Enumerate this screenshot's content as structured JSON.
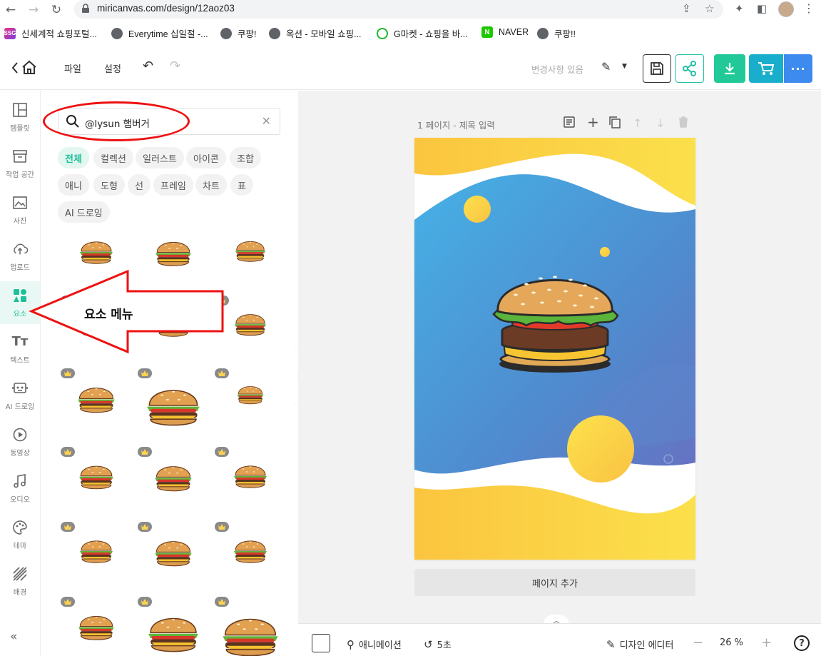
{
  "browser": {
    "url": "miricanvas.com/design/12aoz03",
    "bookmarks": [
      {
        "label": "신세계적 쇼핑포털...",
        "icon": "ssg-icon"
      },
      {
        "label": "Everytime 십일절 -...",
        "icon": "globe-icon"
      },
      {
        "label": "쿠팡!",
        "icon": "globe-icon"
      },
      {
        "label": "옥션 - 모바일 쇼핑...",
        "icon": "globe-icon"
      },
      {
        "label": "G마켓 - 쇼핑을 바...",
        "icon": "gmarket-icon"
      },
      {
        "label": "NAVER",
        "icon": "naver-icon"
      },
      {
        "label": "쿠팡!!",
        "icon": "globe-icon"
      }
    ],
    "ssg_badge": "SSG",
    "naver_badge": "N"
  },
  "header": {
    "menu_file": "파일",
    "menu_settings": "설정",
    "status": "변경사항 있음"
  },
  "sidebar": {
    "items": [
      {
        "label": "템플릿",
        "icon": "template-icon"
      },
      {
        "label": "작업 공간",
        "icon": "workspace-icon"
      },
      {
        "label": "사진",
        "icon": "photo-icon"
      },
      {
        "label": "업로드",
        "icon": "upload-icon"
      },
      {
        "label": "요소",
        "icon": "elements-icon",
        "active": true
      },
      {
        "label": "텍스트",
        "icon": "text-icon"
      },
      {
        "label": "AI 드로잉",
        "icon": "ai-drawing-icon"
      },
      {
        "label": "동영상",
        "icon": "video-icon"
      },
      {
        "label": "오디오",
        "icon": "audio-icon"
      },
      {
        "label": "테마",
        "icon": "theme-icon"
      },
      {
        "label": "배경",
        "icon": "background-icon"
      }
    ]
  },
  "panel": {
    "search_value": "@lysun 햄버거",
    "chips": [
      "전체",
      "컬렉션",
      "일러스트",
      "아이콘",
      "조합",
      "애니",
      "도형",
      "선",
      "프레임",
      "차트",
      "표",
      "AI 드로잉"
    ],
    "active_chip": "전체"
  },
  "annotation": {
    "label": "요소 메뉴"
  },
  "canvas": {
    "page_title": "1 페이지 - 제목 입력",
    "add_page": "페이지 추가"
  },
  "bottom_bar": {
    "animation": "애니메이션",
    "duration": "5초",
    "design_editor": "디자인 에디터",
    "zoom": "26 %",
    "help": "?"
  },
  "colors": {
    "accent": "#1fbf9a",
    "download": "#20c997",
    "cart": "#19aecb",
    "more": "#3e8bf0",
    "annotation": "#e11111"
  }
}
